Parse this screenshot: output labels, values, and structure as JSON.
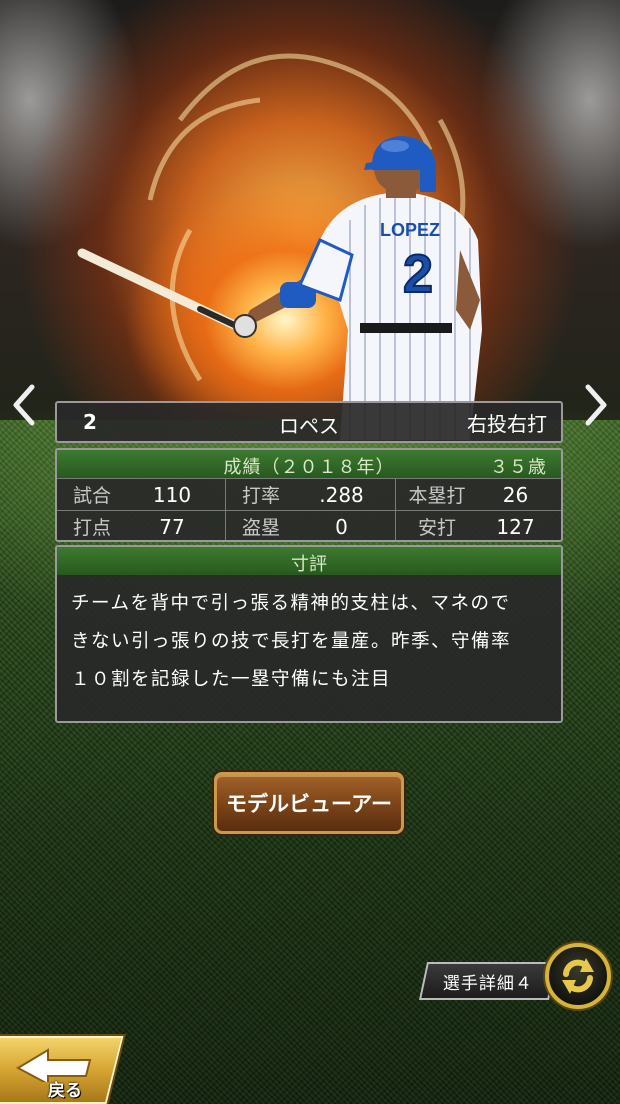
{
  "player": {
    "number": "2",
    "name": "ロペス",
    "throws_bats": "右投右打",
    "jersey_name": "LOPEZ",
    "jersey_number": "2"
  },
  "stats": {
    "header_title": "成績（２０１８年）",
    "age": "３５歳",
    "rows": [
      [
        {
          "label": "試合",
          "value": "110"
        },
        {
          "label": "打率",
          "value": ".288"
        },
        {
          "label": "本塁打",
          "value": "26"
        }
      ],
      [
        {
          "label": "打点",
          "value": "77"
        },
        {
          "label": "盗塁",
          "value": "0"
        },
        {
          "label": "安打",
          "value": "127"
        }
      ]
    ]
  },
  "review": {
    "header": "寸評",
    "lines": [
      "チームを背中で引っ張る精神的支柱は、マネので",
      "きない引っ張りの技で長打を量産。昨季、守備率",
      "１０割を記録した一塁守備にも注目"
    ]
  },
  "buttons": {
    "model_viewer": "モデルビューアー",
    "player_detail": "選手詳細４",
    "back": "戻る"
  },
  "icons": {
    "nav_prev": "chevron-left-icon",
    "nav_next": "chevron-right-icon",
    "swap": "swap-arrows-icon",
    "back": "back-arrow-icon"
  },
  "colors": {
    "header_green": "#28591f",
    "panel_bg": "#282828",
    "button_brown": "#7a4318",
    "back_gold": "#d6a532",
    "jersey_blue": "#1a4fa8"
  }
}
